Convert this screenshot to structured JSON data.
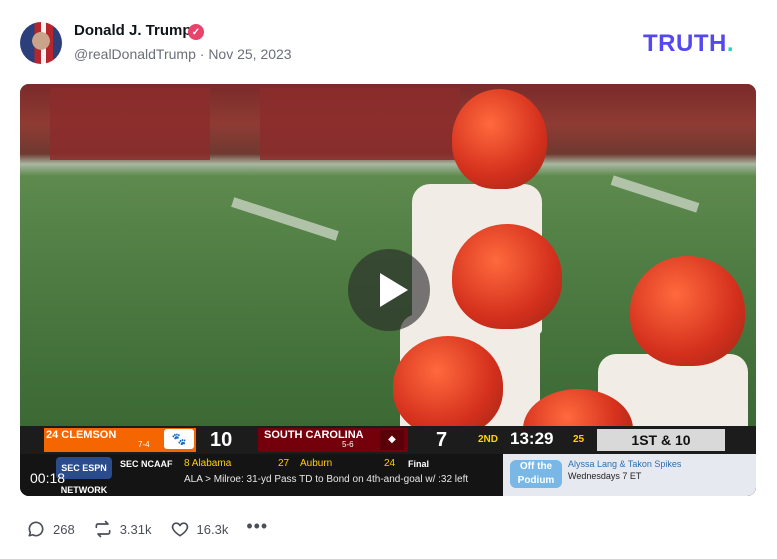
{
  "post": {
    "author_name": "Donald J. Trump",
    "verified_icon": "verified-check-icon",
    "handle": "@realDonaldTrump",
    "separator": "·",
    "date": "Nov 25, 2023",
    "brand_logo": {
      "text": "TRUTH",
      "dot": ".",
      "color": "#5448ee",
      "dot_color": "#1fd7c4"
    }
  },
  "video": {
    "play_icon": "play-icon",
    "elapsed": "00:18",
    "scoreboard": {
      "team1_name": "24 CLEMSON",
      "team1_record": "7-4",
      "team1_score": "10",
      "team1_color": "#f56600",
      "team2_name": "SOUTH CAROLINA",
      "team2_record": "5-6",
      "team2_score": "7",
      "team2_color": "#73000a",
      "quarter": "2ND",
      "clock": "13:29",
      "play_clock": "25",
      "down_distance": "1ST & 10"
    },
    "ticker": {
      "network": "SEC ESPN NETWORK",
      "label": "SEC NCAAF",
      "team1": "8 Alabama",
      "team1_score": "27",
      "team2": "Auburn",
      "team2_score": "24",
      "status": "Final",
      "headline": "ALA > Milroe: 31-yd Pass TD to Bond on 4th-and-goal w/ :32 left",
      "promo_logo": "Off the Podium",
      "promo_line1": "Alyssa Lang & Takon Spikes",
      "promo_line2": "Wednesdays 7 ET"
    }
  },
  "actions": {
    "replies": "268",
    "retruths": "3.31k",
    "likes": "16.3k",
    "more": "•••"
  }
}
